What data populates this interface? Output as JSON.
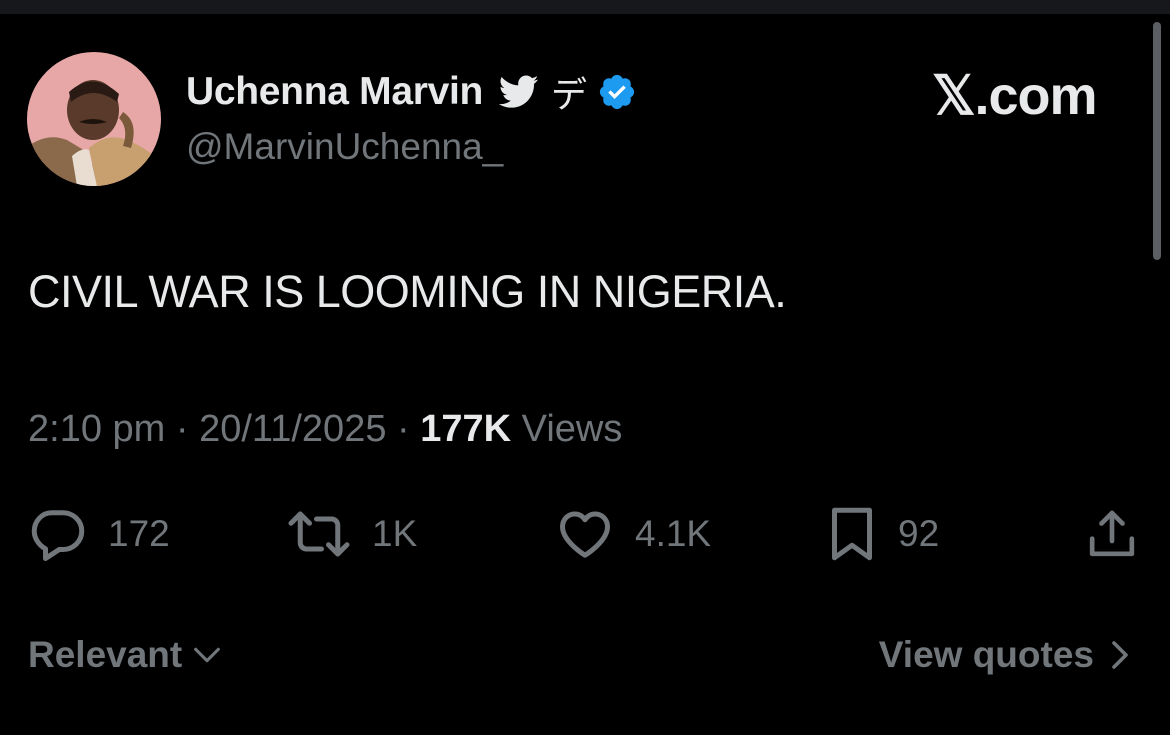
{
  "colors": {
    "background": "#000000",
    "primary_text": "#e7e9ea",
    "secondary_text": "#71767b",
    "verified_blue": "#1d9bf0"
  },
  "author": {
    "display_name": "Uchenna Marvin",
    "name_glyph": "デ",
    "handle": "@MarvinUchenna_",
    "icons": [
      "bird-icon",
      "verified-badge-icon"
    ]
  },
  "brand": {
    "logo_text": "𝕏.com"
  },
  "tweet": {
    "text": "CIVIL WAR IS LOOMING IN NIGERIA.",
    "time": "2:10 pm",
    "separator": "·",
    "date": "20/11/2025",
    "views_count": "177K",
    "views_label": "Views"
  },
  "actions": {
    "replies": "172",
    "reposts": "1K",
    "likes": "4.1K",
    "bookmarks": "92",
    "icons": [
      "reply-icon",
      "repost-icon",
      "like-icon",
      "bookmark-icon",
      "share-icon"
    ]
  },
  "footer": {
    "sort_label": "Relevant",
    "view_quotes_label": "View quotes"
  }
}
